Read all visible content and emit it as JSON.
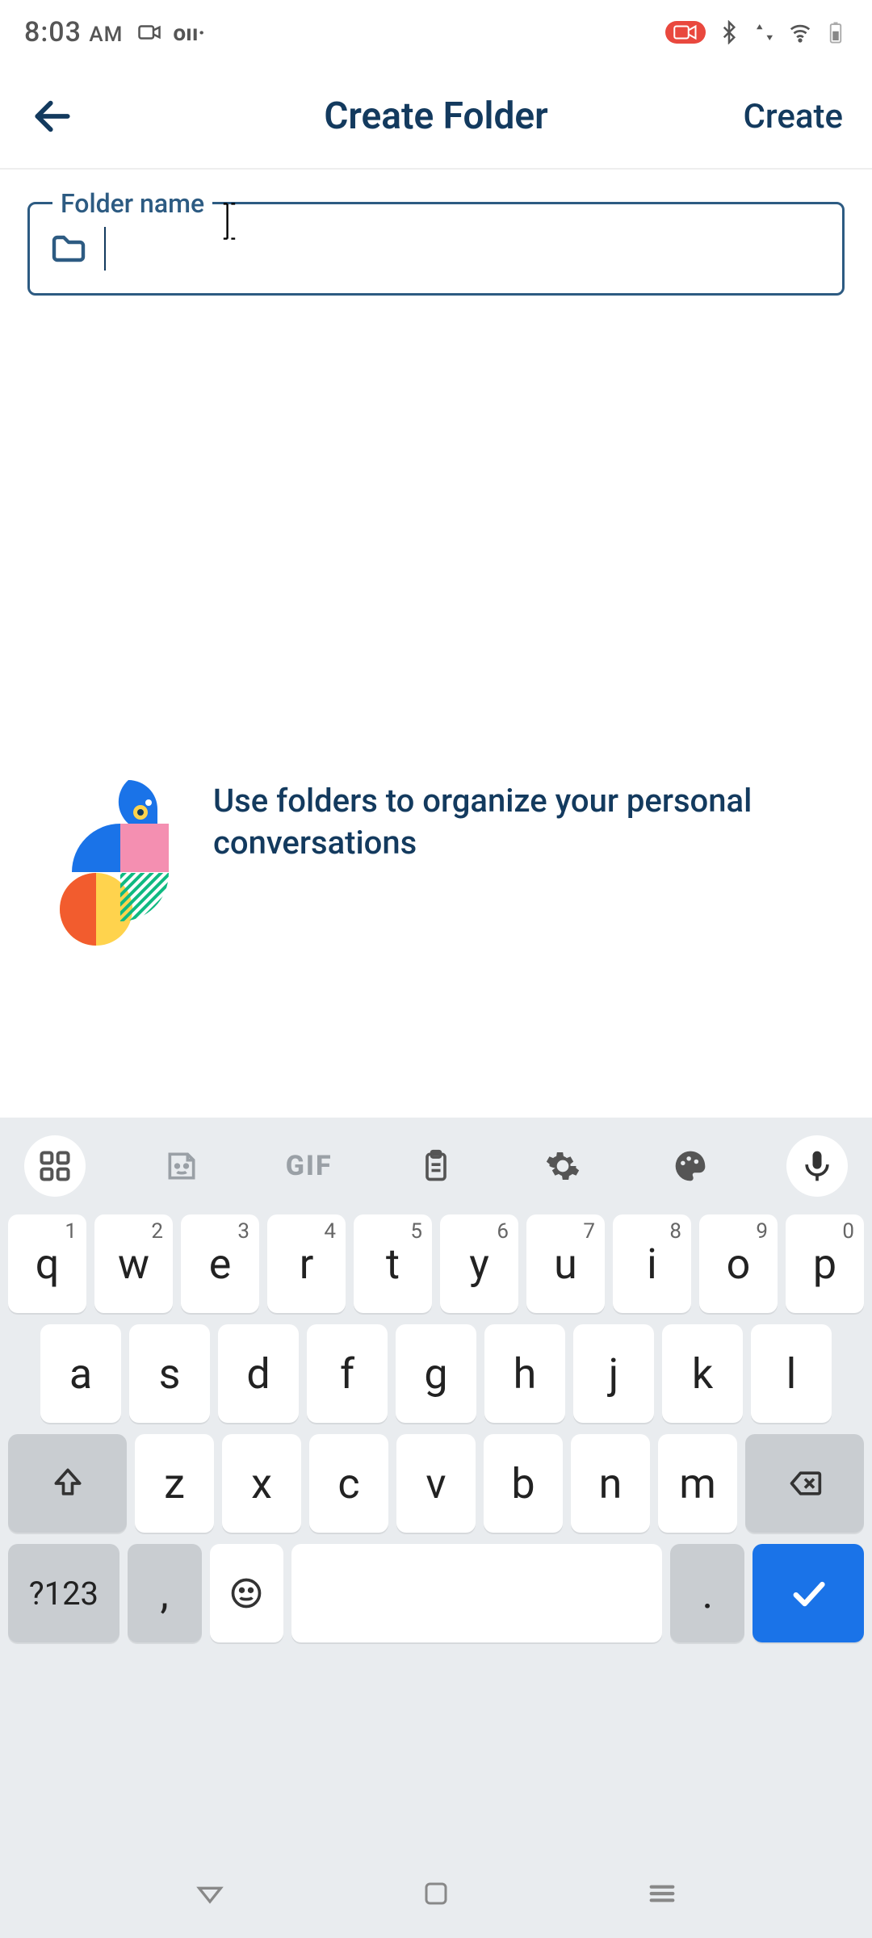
{
  "status": {
    "time": "8:03",
    "ampm": "AM"
  },
  "header": {
    "title": "Create Folder",
    "action": "Create"
  },
  "form": {
    "label": "Folder name",
    "value": ""
  },
  "hint": {
    "text": "Use folders to organize your personal conversations"
  },
  "keyboard": {
    "gif": "GIF",
    "symKey": "?123",
    "row1": [
      {
        "main": "q",
        "sup": "1"
      },
      {
        "main": "w",
        "sup": "2"
      },
      {
        "main": "e",
        "sup": "3"
      },
      {
        "main": "r",
        "sup": "4"
      },
      {
        "main": "t",
        "sup": "5"
      },
      {
        "main": "y",
        "sup": "6"
      },
      {
        "main": "u",
        "sup": "7"
      },
      {
        "main": "i",
        "sup": "8"
      },
      {
        "main": "o",
        "sup": "9"
      },
      {
        "main": "p",
        "sup": "0"
      }
    ],
    "row2": [
      "a",
      "s",
      "d",
      "f",
      "g",
      "h",
      "j",
      "k",
      "l"
    ],
    "row3": [
      "z",
      "x",
      "c",
      "v",
      "b",
      "n",
      "m"
    ],
    "comma": ",",
    "period": "."
  }
}
